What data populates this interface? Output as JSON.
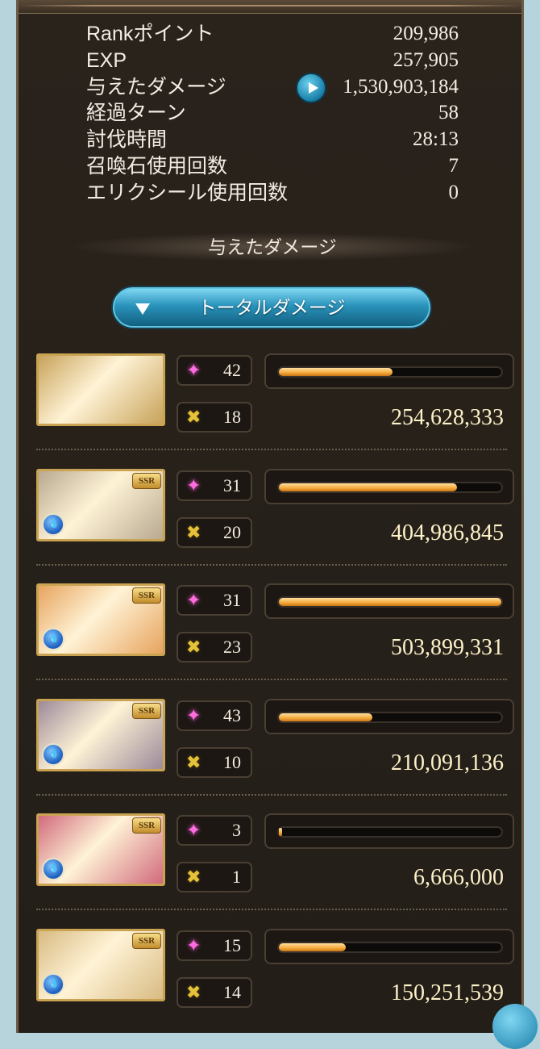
{
  "stats": [
    {
      "label": "Rankポイント",
      "value": "209,986"
    },
    {
      "label": "EXP",
      "value": "257,905"
    },
    {
      "label": "与えたダメージ",
      "value": "1,530,903,184"
    },
    {
      "label": "経過ターン",
      "value": "58"
    },
    {
      "label": "討伐時間",
      "value": "28:13"
    },
    {
      "label": "召喚石使用回数",
      "value": "7"
    },
    {
      "label": "エリクシール使用回数",
      "value": "0"
    }
  ],
  "section_title": "与えたダメージ",
  "dropdown": {
    "label": "トータルダメージ"
  },
  "characters": [
    {
      "portrait": "twin-gold-helmet-characters",
      "rarity": "",
      "element_icon": "",
      "skill_count": "42",
      "attack_count": "18",
      "damage": "254,628,333",
      "damage_ratio": 0.51,
      "bg": "#c8a35a"
    },
    {
      "portrait": "blonde-girl-character",
      "rarity": "SSR",
      "element_icon": "water-element-icon",
      "skill_count": "31",
      "attack_count": "20",
      "damage": "404,986,845",
      "damage_ratio": 0.8,
      "bg": "#b8a990"
    },
    {
      "portrait": "fire-hair-character",
      "rarity": "SSR",
      "element_icon": "water-element-icon",
      "skill_count": "31",
      "attack_count": "23",
      "damage": "503,899,331",
      "damage_ratio": 1.0,
      "bg": "#e7a45e"
    },
    {
      "portrait": "silver-hair-character",
      "rarity": "SSR",
      "element_icon": "water-element-icon",
      "skill_count": "43",
      "attack_count": "10",
      "damage": "210,091,136",
      "damage_ratio": 0.42,
      "bg": "#9c8a9a"
    },
    {
      "portrait": "pink-hair-character",
      "rarity": "SSR",
      "element_icon": "water-element-icon",
      "skill_count": "3",
      "attack_count": "1",
      "damage": "6,666,000",
      "damage_ratio": 0.013,
      "bg": "#d16a7c"
    },
    {
      "portrait": "blonde-long-hair-character",
      "rarity": "SSR",
      "element_icon": "water-element-icon",
      "skill_count": "15",
      "attack_count": "14",
      "damage": "150,251,539",
      "damage_ratio": 0.3,
      "bg": "#d8bb83"
    }
  ],
  "colors": {
    "bar": "#f4a93a",
    "panel": "#2a231c",
    "accent": "#2a93bb"
  }
}
